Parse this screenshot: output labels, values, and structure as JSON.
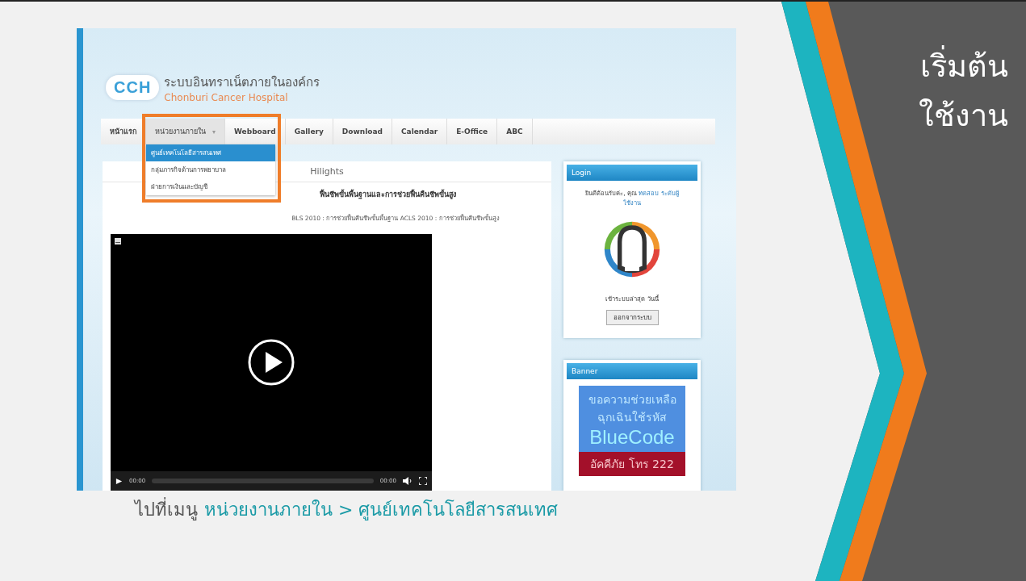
{
  "slide": {
    "title_lines": [
      "เริ่มต้น",
      "ใช้งาน"
    ],
    "caption": {
      "prefix": "ไปที่เมนู",
      "path": "หน่วยงานภายใน > ศูนย์เทคโนโลยีสารสนเทศ"
    }
  },
  "site": {
    "logo": "CCH",
    "title": "ระบบอินทราเน็ตภายในองค์กร",
    "subtitle": "Chonburi Cancer Hospital"
  },
  "nav": [
    {
      "label": "หน้าแรก",
      "expanded": false
    },
    {
      "label": "หน่วยงานภายใน",
      "expanded": true,
      "caret": "▾"
    },
    {
      "label": "Webboard",
      "expanded": false
    },
    {
      "label": "Gallery",
      "expanded": false
    },
    {
      "label": "Download",
      "expanded": false
    },
    {
      "label": "Calendar",
      "expanded": false
    },
    {
      "label": "E-Office",
      "expanded": false
    },
    {
      "label": "ABC",
      "expanded": false
    }
  ],
  "dropdown": [
    {
      "label": "ศูนย์เทคโนโลยีสารสนเทศ",
      "selected": true
    },
    {
      "label": "กลุ่มภารกิจด้านการพยาบาล",
      "selected": false
    },
    {
      "label": "ฝ่ายการเงินและบัญชี",
      "selected": false
    }
  ],
  "highlights": {
    "heading": "Hilights",
    "headline": "ฟื้นชีพขั้นพื้นฐานและการช่วยฟื้นคืนชีพขั้นสูง",
    "subline": "BLS 2010 : การช่วยฟื้นคืนชีพขั้นพื้นฐาน ACLS 2010 : การช่วยฟื้นคืนชีพขั้นสูง"
  },
  "video": {
    "current": "00:00",
    "duration": "00:00"
  },
  "login": {
    "title": "Login",
    "greeting": "ยินดีต้อนรับค่ะ, คุณ",
    "user": "ทดสอบ ระดับผู้",
    "user_2": "ใช้งาน",
    "last_login": "เข้าระบบล่าสุด วันนี้",
    "logout": "ออกจากระบบ"
  },
  "banner": {
    "title": "Banner",
    "lines": [
      {
        "kind": "thai",
        "text": "ขอความช่วยเหลือ"
      },
      {
        "kind": "thai",
        "text": "ฉุกเฉินใช้รหัส"
      },
      {
        "kind": "brand",
        "text": "BlueCode"
      },
      {
        "kind": "alert",
        "text": "อัคคีภัย โทร 222"
      }
    ]
  }
}
